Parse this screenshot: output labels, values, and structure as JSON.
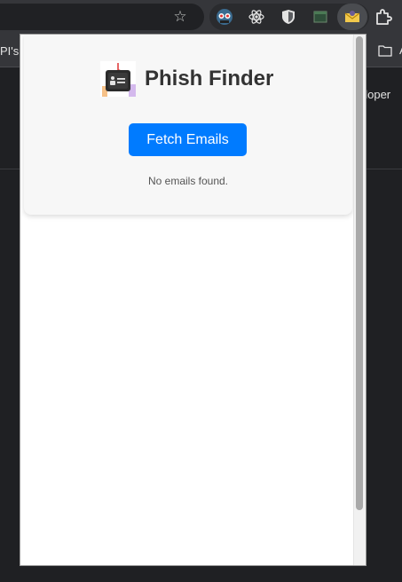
{
  "browser": {
    "bookmarks": {
      "left_label": "PI's",
      "folder_label": "A"
    },
    "page_text": "eloper"
  },
  "popup": {
    "title": "Phish Finder",
    "fetch_button_label": "Fetch Emails",
    "status_text": "No emails found."
  },
  "colors": {
    "accent": "#007bff",
    "title": "#333333"
  },
  "icons": [
    "star-icon",
    "profile-extension-icon",
    "react-extension-icon",
    "shield-extension-icon",
    "window-extension-icon",
    "phish-finder-extension-icon",
    "puzzle-icon",
    "folder-icon",
    "phish-finder-logo-icon"
  ]
}
